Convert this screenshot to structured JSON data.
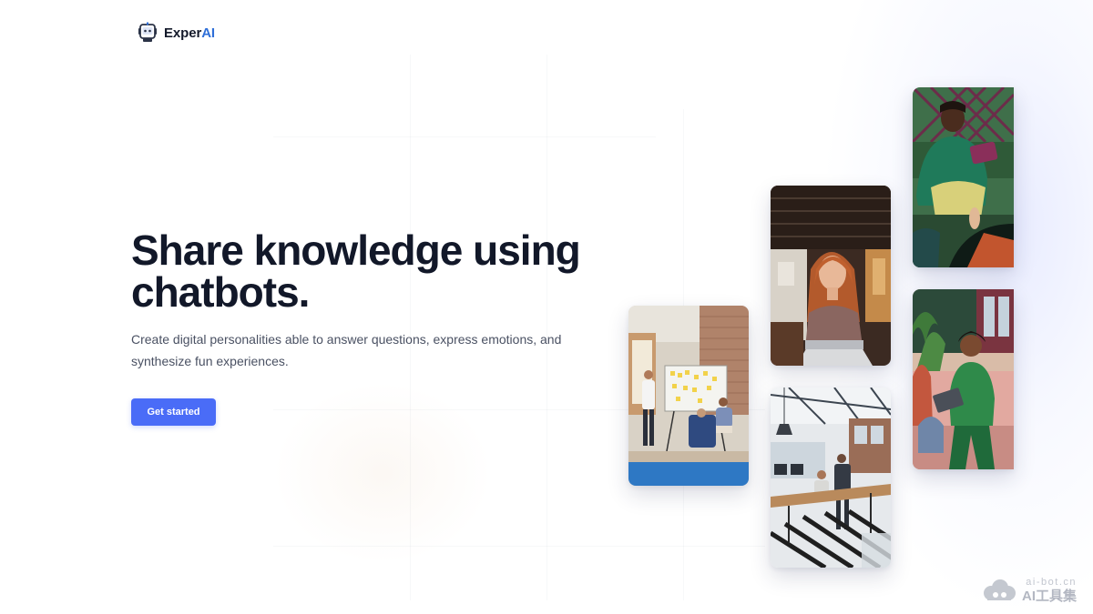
{
  "brand": {
    "name_prefix": "Exper",
    "name_accent": "AI",
    "logo_icon": "robot-icon",
    "accent_color": "#2f6fd8"
  },
  "hero": {
    "title": "Share knowledge using chatbots.",
    "subtitle": "Create digital personalities able to answer questions, express emotions, and synthesize fun experiences.",
    "cta_label": "Get started",
    "cta_color": "#4a6cf7"
  },
  "gallery": [
    {
      "name": "team-whiteboard-meeting-photo"
    },
    {
      "name": "woman-using-laptop-photo"
    },
    {
      "name": "open-office-workspace-photo"
    },
    {
      "name": "man-laughing-with-tablet-photo"
    },
    {
      "name": "woman-in-green-sweater-photo"
    }
  ],
  "watermark": {
    "domain": "ai-bot.cn",
    "label": "AI工具集"
  }
}
